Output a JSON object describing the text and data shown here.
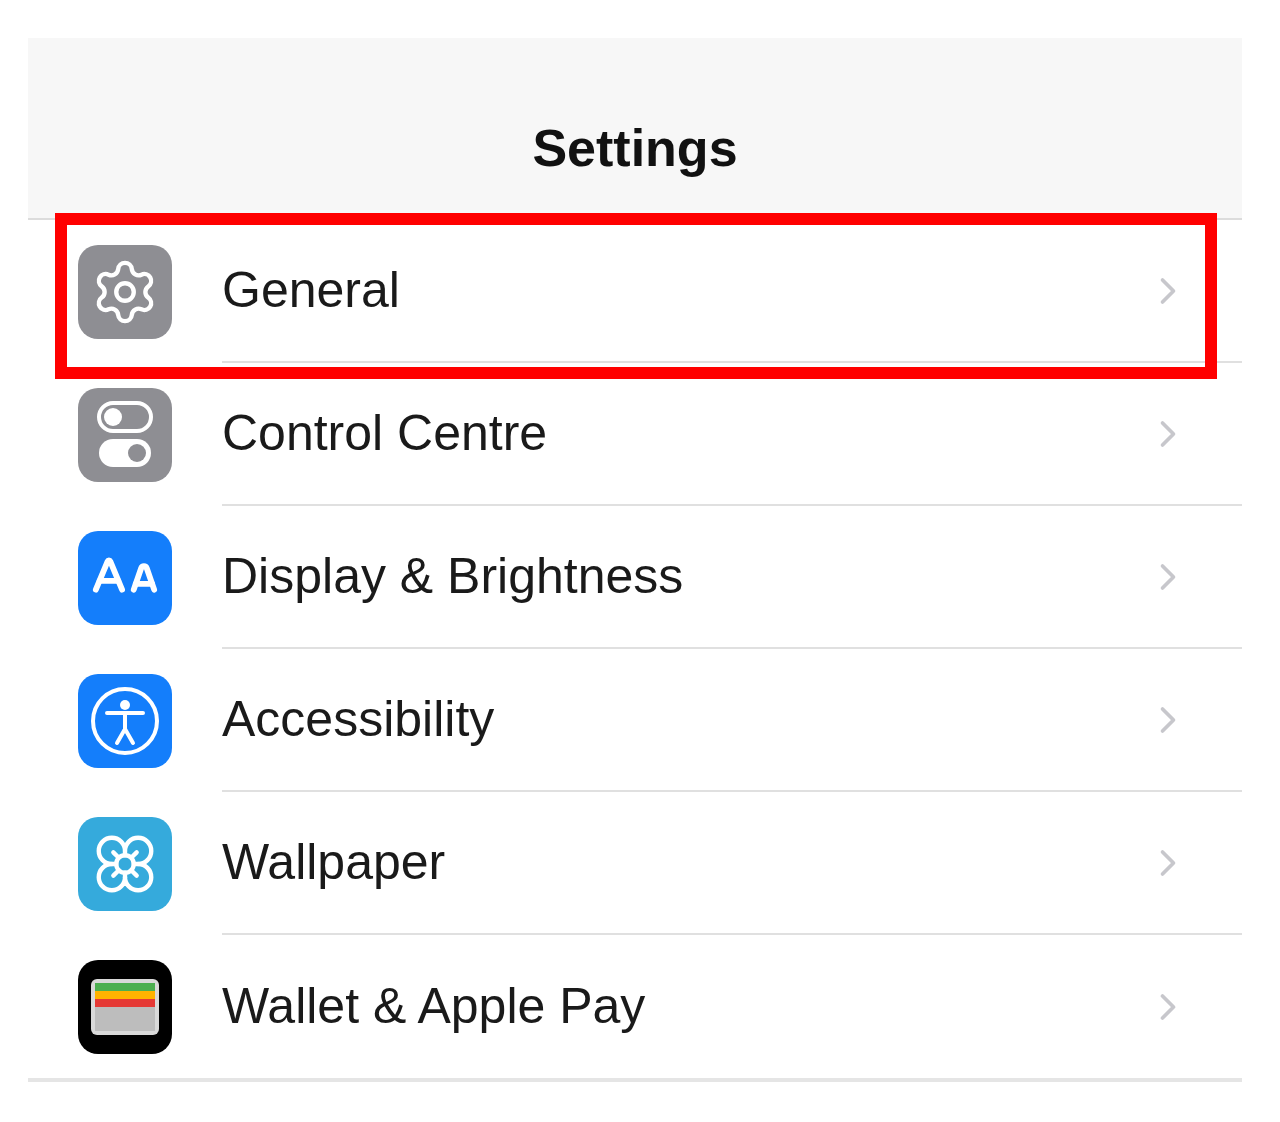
{
  "header": {
    "title": "Settings"
  },
  "rows": [
    {
      "label": "General",
      "kind": "gear",
      "color": "#8e8e93",
      "highlighted": true
    },
    {
      "label": "Control Centre",
      "kind": "toggles",
      "color": "#8e8e93",
      "highlighted": false
    },
    {
      "label": "Display & Brightness",
      "kind": "text-size",
      "color": "#147efb",
      "highlighted": false
    },
    {
      "label": "Accessibility",
      "kind": "accessibility",
      "color": "#147efb",
      "highlighted": false
    },
    {
      "label": "Wallpaper",
      "kind": "flower",
      "color": "#35aadc",
      "highlighted": false
    },
    {
      "label": "Wallet & Apple Pay",
      "kind": "wallet",
      "color": "#000000",
      "highlighted": false
    }
  ]
}
